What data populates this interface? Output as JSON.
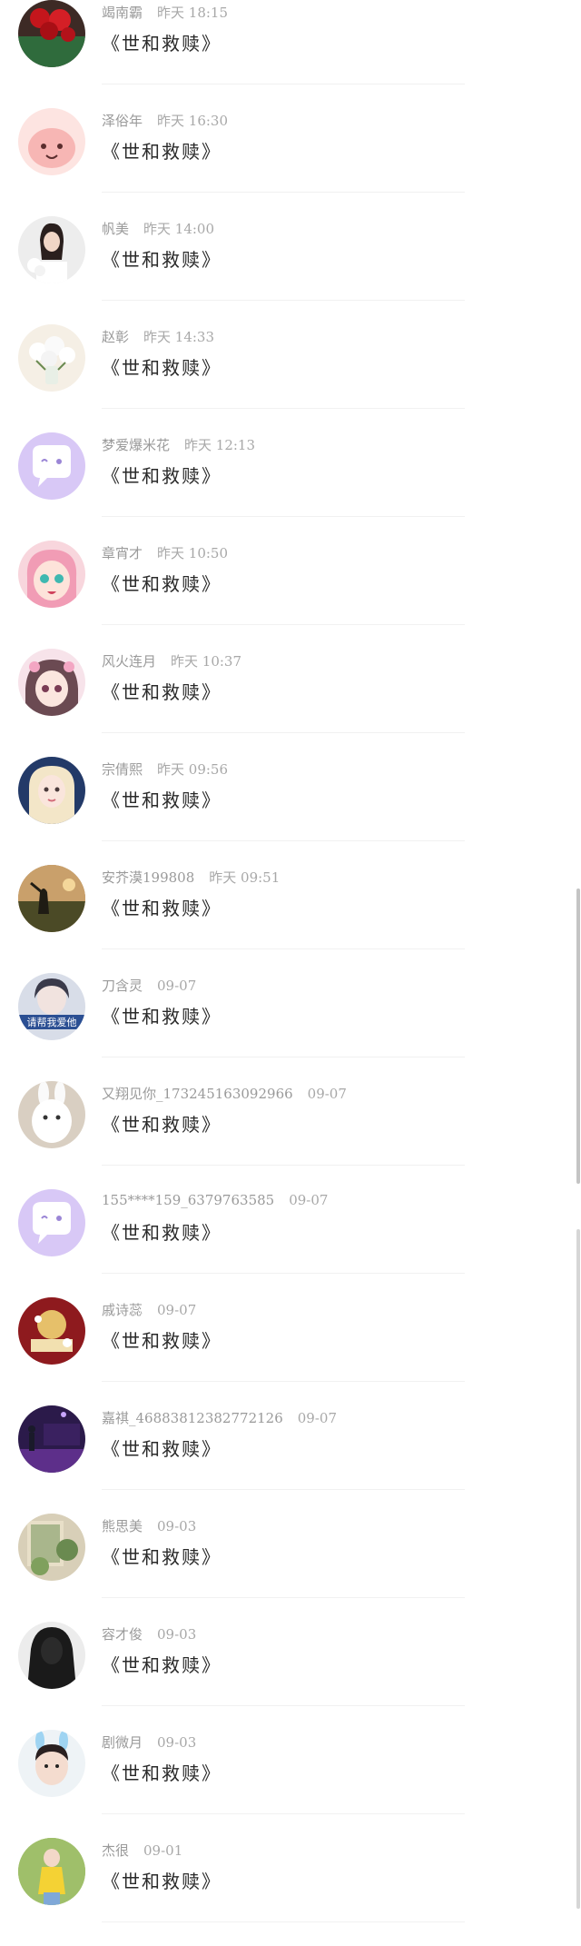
{
  "colors": {
    "accent": "#c9b5f2",
    "divider": "#f1f1f1",
    "name_text": "#9a9a9a",
    "title_text": "#2a2a2a"
  },
  "comments": [
    {
      "name": "竭南霸",
      "time": "昨天 18:15",
      "text": "《世和救赎》",
      "avatar_icon": "red-roses-avatar"
    },
    {
      "name": "泽俗年",
      "time": "昨天 16:30",
      "text": "《世和救赎》",
      "avatar_icon": "pink-cartoon-avatar"
    },
    {
      "name": "帆美",
      "time": "昨天 14:00",
      "text": "《世和救赎》",
      "avatar_icon": "girl-with-flowers-avatar"
    },
    {
      "name": "赵彰",
      "time": "昨天 14:33",
      "text": "《世和救赎》",
      "avatar_icon": "white-flowers-avatar"
    },
    {
      "name": "梦爱爆米花",
      "time": "昨天 12:13",
      "text": "《世和救赎》",
      "avatar_icon": "default-chat-avatar"
    },
    {
      "name": "章宵才",
      "time": "昨天 10:50",
      "text": "《世和救赎》",
      "avatar_icon": "anime-pink-hair-avatar"
    },
    {
      "name": "风火连月",
      "time": "昨天 10:37",
      "text": "《世和救赎》",
      "avatar_icon": "anime-girl-avatar"
    },
    {
      "name": "宗倩熙",
      "time": "昨天 09:56",
      "text": "《世和救赎》",
      "avatar_icon": "blonde-girl-avatar"
    },
    {
      "name": "安芥漠199808",
      "time": "昨天 09:51",
      "text": "《世和救赎》",
      "avatar_icon": "sunset-silhouette-avatar"
    },
    {
      "name": "刀含灵",
      "time": "09-07",
      "text": "《世和救赎》",
      "avatar_icon": "girl-banner-avatar"
    },
    {
      "name": "又翔见你_17324516309​2966",
      "time": "09-07",
      "text": "《世和救赎》",
      "avatar_icon": "white-bunny-avatar"
    },
    {
      "name": "155****159_6379763585",
      "time": "09-07",
      "text": "《世和救赎》",
      "avatar_icon": "default-chat-avatar"
    },
    {
      "name": "戚诗蕊",
      "time": "09-07",
      "text": "《世和救赎》",
      "avatar_icon": "red-poster-avatar"
    },
    {
      "name": "嘉祺_4688381238277​2126",
      "time": "09-07",
      "text": "《世和救赎》",
      "avatar_icon": "purple-piano-avatar"
    },
    {
      "name": "熊思美",
      "time": "09-03",
      "text": "《世和救赎》",
      "avatar_icon": "garden-window-avatar"
    },
    {
      "name": "容才俊",
      "time": "09-03",
      "text": "《世和救赎》",
      "avatar_icon": "dark-hair-avatar"
    },
    {
      "name": "剧微月",
      "time": "09-03",
      "text": "《世和救赎》",
      "avatar_icon": "child-bunny-ears-avatar"
    },
    {
      "name": "杰很",
      "time": "09-01",
      "text": "《世和救赎》",
      "avatar_icon": "yellow-outfit-avatar"
    }
  ],
  "scrollbar": {
    "position_fraction": 0.48
  }
}
